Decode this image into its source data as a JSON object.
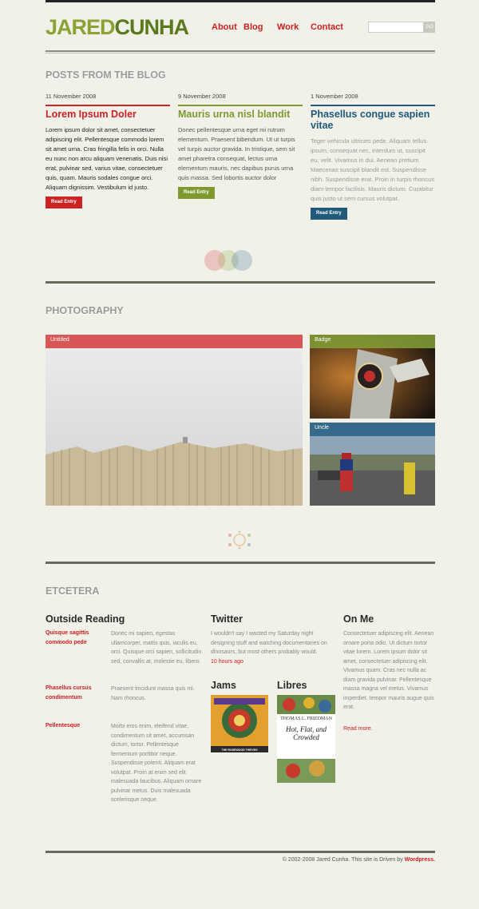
{
  "header": {
    "logo_part1": "JARED",
    "logo_part2": "CUNHA",
    "nav": [
      {
        "label": "About"
      },
      {
        "label": "Blog"
      },
      {
        "label": "Work"
      },
      {
        "label": "Contact"
      }
    ],
    "search": {
      "value": "",
      "go_label": "GO"
    }
  },
  "blog": {
    "section_title": "POSTS FROM THE BLOG",
    "posts": [
      {
        "date": "11 November 2008",
        "title": "Lorem Ipsum Doler",
        "body": "Lorem ipsum dolor sit amet, consectetuer adipiscing elit. Pellentesque commodo lorem sit amet urna. Cras fringilla felis in orci. Nulla eu nunc non arcu aliquam venenatis. Duis nisi erat, pulvinar sed, varius vitae, consectetuer quis, quam. Mauris sodales congue orci. Aliquam dignissim. Vestibulum id justo.",
        "button": "Read Entry",
        "color": "#cc2222"
      },
      {
        "date": "9 November 2008",
        "title": "Mauris urna nisl blandit",
        "body": "Donec pellentesque urna eget mi rutrum elementum. Praesent bibendum. Ut ut turpis vel turpis auctor gravida. In tristique, sem sit amet pharetra consequat, lectus urna elementum mauris, nec dapibus purus urna quis massa. Sed lobortis auctor dolor",
        "button": "Read Entry",
        "color": "#7e9a2e"
      },
      {
        "date": "1 November 2008",
        "title": "Phasellus congue sapien vitae",
        "body": "Teger vehicula ultricies pede. Aliquam tellus ipsum, consequat nec, interdum ut, suscipit eu, velit. Vivamus in dui. Aenean pretium. Maecenas suscipit blandit est. Suspendisse nibh. Suspendisse erat. Proin in turpis rhoncus diam tempor facilisis. Mauris dictum. Curabitur quis justo ut sem cursus volutpat.",
        "button": "Read Entry",
        "color": "#1f5a7a"
      }
    ]
  },
  "photography": {
    "section_title": "PHOTOGRAPHY",
    "photos": [
      {
        "caption": "Untitled"
      },
      {
        "caption": "Badge"
      },
      {
        "caption": "Uncle"
      }
    ]
  },
  "etcetera": {
    "section_title": "ETCETERA",
    "outside_reading": {
      "title": "Outside Reading",
      "items": [
        {
          "link": "Quisque sagittis commodo pede",
          "desc": "Donec mi sapien, egestas ullamcorper, mattis quis, iaculis eu, orci. Quisque orci sapien, sollicitudin sed, convallis at, molestie eu, libero."
        },
        {
          "link": "Phasellus cursus condimentum",
          "desc": "Praesent tincidunt massa quis mi. Nam rhoncus."
        },
        {
          "link": "Pellentesque",
          "desc": "Morbi eros enim, eleifend vitae, condimentum sit amet, accumsan dictum, tortor. Pellentesque fermentum porttitor neque. Suspendisse potenti. Aliquam erat volutpat. Proin at enim sed elit malesuada faucibus. Aliquam ornare pulvinar metus. Duis malesuada scelerisque neque."
        }
      ]
    },
    "twitter": {
      "title": "Twitter",
      "text": "I wouldn't say I wasted my Saturday night designing stuff and watching documentaries on dinosaurs, but most others probably would.",
      "time": "10 hours ago"
    },
    "jams": {
      "title": "Jams",
      "album_text": "THE ROSEWOOD THIEVES"
    },
    "libres": {
      "title": "Libres",
      "book_author": "THOMAS L. FRIEDMAN",
      "book_title": "Hot, Flat, and Crowded"
    },
    "on_me": {
      "title": "On Me",
      "text": "Consectetuer adipiscing elit. Aenean ornare porta odio. Ut dictum tortor vitae lorem. Lorem ipsum dolor sit amet, consectetuer adipiscing elit. Vivamus quam. Cras nec nulla ac diam gravida pulvinar. Pellentesque massa magna vel metus. Vivamus imperdiet. tempor mauris augue quis erat.",
      "more": "Read more."
    }
  },
  "footer": {
    "text": "© 2002-2008 Jared Cunha. This site is Driven by",
    "link": "Wordpress."
  }
}
